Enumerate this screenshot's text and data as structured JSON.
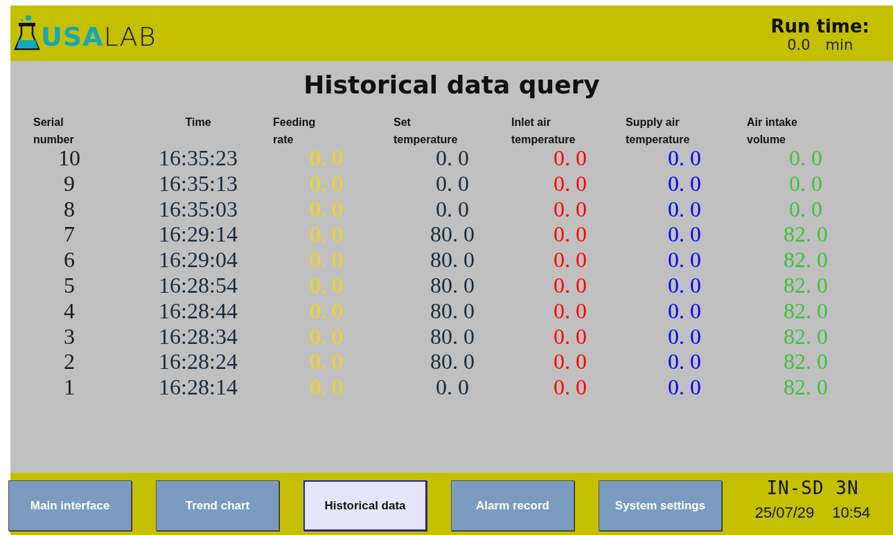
{
  "header": {
    "logo": {
      "brand_part1": "USA",
      "brand_part2": "LAB"
    },
    "run_time": {
      "label": "Run time:",
      "value": "0.0",
      "unit": "min"
    }
  },
  "title": "Historical data query",
  "table": {
    "columns": [
      {
        "label": "Serial number",
        "color": "#1a1a1a"
      },
      {
        "label": "Time",
        "color": "#1a2a3a"
      },
      {
        "label": "Feeding rate",
        "color": "#f0dc00"
      },
      {
        "label": "Set temperature",
        "color": "#1a2a3a"
      },
      {
        "label": "Inlet air temperature",
        "color": "#ff0000"
      },
      {
        "label": "Supply air temperature",
        "color": "#0000ff"
      },
      {
        "label": "Air intake volume",
        "color": "#40c040"
      }
    ],
    "rows": [
      [
        "10",
        "16:35:23",
        "0. 0",
        "0. 0",
        "0. 0",
        "0. 0",
        "0. 0"
      ],
      [
        "9",
        "16:35:13",
        "0. 0",
        "0. 0",
        "0. 0",
        "0. 0",
        "0. 0"
      ],
      [
        "8",
        "16:35:03",
        "0. 0",
        "0. 0",
        "0. 0",
        "0. 0",
        "0. 0"
      ],
      [
        "7",
        "16:29:14",
        "0. 0",
        "80. 0",
        "0. 0",
        "0. 0",
        "82. 0"
      ],
      [
        "6",
        "16:29:04",
        "0. 0",
        "80. 0",
        "0. 0",
        "0. 0",
        "82. 0"
      ],
      [
        "5",
        "16:28:54",
        "0. 0",
        "80. 0",
        "0. 0",
        "0. 0",
        "82. 0"
      ],
      [
        "4",
        "16:28:44",
        "0. 0",
        "80. 0",
        "0. 0",
        "0. 0",
        "82. 0"
      ],
      [
        "3",
        "16:28:34",
        "0. 0",
        "80. 0",
        "0. 0",
        "0. 0",
        "82. 0"
      ],
      [
        "2",
        "16:28:24",
        "0. 0",
        "80. 0",
        "0. 0",
        "0. 0",
        "82. 0"
      ],
      [
        "1",
        "16:28:14",
        "0. 0",
        "0. 0",
        "0. 0",
        "0. 0",
        "82. 0"
      ]
    ]
  },
  "nav": [
    {
      "label": "Main interface",
      "selected": false
    },
    {
      "label": "Trend chart",
      "selected": false
    },
    {
      "label": "Historical data",
      "selected": true
    },
    {
      "label": "Alarm record",
      "selected": false
    },
    {
      "label": "System settings",
      "selected": false
    }
  ],
  "status": {
    "model": "IN-SD 3N",
    "date": "25/07/29",
    "time": "10:54"
  }
}
